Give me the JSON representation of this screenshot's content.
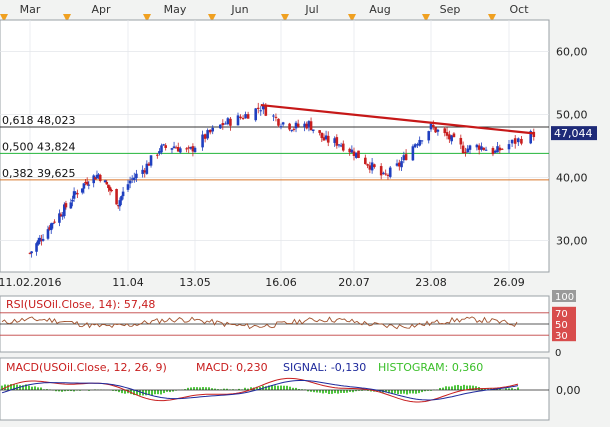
{
  "colors": {
    "background": "#ffffff",
    "panel_border": "#9aa0a6",
    "grid": "#e3e6ea",
    "candle_up": "#1f3fbf",
    "candle_down": "#c81e1e",
    "fib_618": "#333333",
    "fib_500": "#22b43a",
    "fib_382": "#d9762a",
    "trendline": "#c61818",
    "price_label_bg": "#1e2a78",
    "rsi_line": "#a0522d",
    "rsi_70": "#c04040",
    "rsi_50": "#222222",
    "rsi_30": "#c04040",
    "macd_line": "#c81e1e",
    "signal_line": "#1f2a9c",
    "histogram": "#3bbf2a",
    "month_marker": "#f0a020"
  },
  "timeline": {
    "months": [
      "Mar",
      "Apr",
      "May",
      "Jun",
      "Jul",
      "Aug",
      "Sep",
      "Oct"
    ]
  },
  "chart_data": [
    {
      "type": "candlestick",
      "name": "price-panel",
      "x_dates": [
        "11.02.2016",
        "11.04",
        "13.05",
        "16.06",
        "20.07",
        "23.08",
        "26.09"
      ],
      "ylim": [
        25,
        65
      ],
      "y_ticks": [
        "30,00",
        "40,00",
        "50,00",
        "60,00"
      ],
      "last_price": "47,044",
      "fib_levels": [
        {
          "label": "0,618",
          "value": "48,023",
          "level": 48.023
        },
        {
          "label": "0,500",
          "value": "43,824",
          "level": 43.824
        },
        {
          "label": "0,382",
          "value": "39,625",
          "level": 39.625
        }
      ],
      "trendline": [
        {
          "x": "2016-06-08",
          "y": 51.5
        },
        {
          "x": "2016-10-04",
          "y": 47.0
        }
      ],
      "path_points": [
        [
          "2016-02-11",
          28.0
        ],
        [
          "2016-02-18",
          30.5
        ],
        [
          "2016-02-25",
          33.0
        ],
        [
          "2016-03-03",
          35.0
        ],
        [
          "2016-03-10",
          37.5
        ],
        [
          "2016-03-17",
          39.5
        ],
        [
          "2016-03-24",
          40.5
        ],
        [
          "2016-03-31",
          38.0
        ],
        [
          "2016-04-05",
          36.0
        ],
        [
          "2016-04-12",
          39.5
        ],
        [
          "2016-04-19",
          41.5
        ],
        [
          "2016-04-26",
          44.5
        ],
        [
          "2016-05-03",
          45.0
        ],
        [
          "2016-05-10",
          44.0
        ],
        [
          "2016-05-17",
          46.5
        ],
        [
          "2016-05-24",
          48.5
        ],
        [
          "2016-05-31",
          49.5
        ],
        [
          "2016-06-08",
          51.2
        ],
        [
          "2016-06-15",
          49.0
        ],
        [
          "2016-06-22",
          48.0
        ],
        [
          "2016-06-29",
          48.5
        ],
        [
          "2016-07-06",
          46.0
        ],
        [
          "2016-07-13",
          45.5
        ],
        [
          "2016-07-20",
          44.0
        ],
        [
          "2016-07-27",
          42.0
        ],
        [
          "2016-08-02",
          40.0
        ],
        [
          "2016-08-09",
          42.0
        ],
        [
          "2016-08-16",
          45.5
        ],
        [
          "2016-08-23",
          48.0
        ],
        [
          "2016-08-30",
          46.5
        ],
        [
          "2016-09-06",
          44.5
        ],
        [
          "2016-09-13",
          45.0
        ],
        [
          "2016-09-20",
          44.0
        ],
        [
          "2016-09-27",
          45.5
        ],
        [
          "2016-10-04",
          47.0
        ]
      ]
    },
    {
      "type": "line",
      "name": "rsi-panel",
      "title": "RSI(USOil.Close, 14): 57,48",
      "ylim": [
        0,
        100
      ],
      "y_ticks": [
        "100",
        "70",
        "50",
        "30",
        "0"
      ],
      "levels": [
        70,
        50,
        30
      ]
    },
    {
      "type": "line",
      "name": "macd-panel",
      "title_parts": [
        {
          "text": "MACD(USOil.Close, 12, 26, 9)",
          "color": "#c81e1e"
        },
        {
          "text": "MACD: 0,230",
          "color": "#c81e1e"
        },
        {
          "text": "SIGNAL: -0,130",
          "color": "#1f2a9c"
        },
        {
          "text": "HISTOGRAM: 0,360",
          "color": "#3bbf2a"
        }
      ],
      "y_ticks": [
        "0,00"
      ],
      "zero_level": 0
    }
  ]
}
